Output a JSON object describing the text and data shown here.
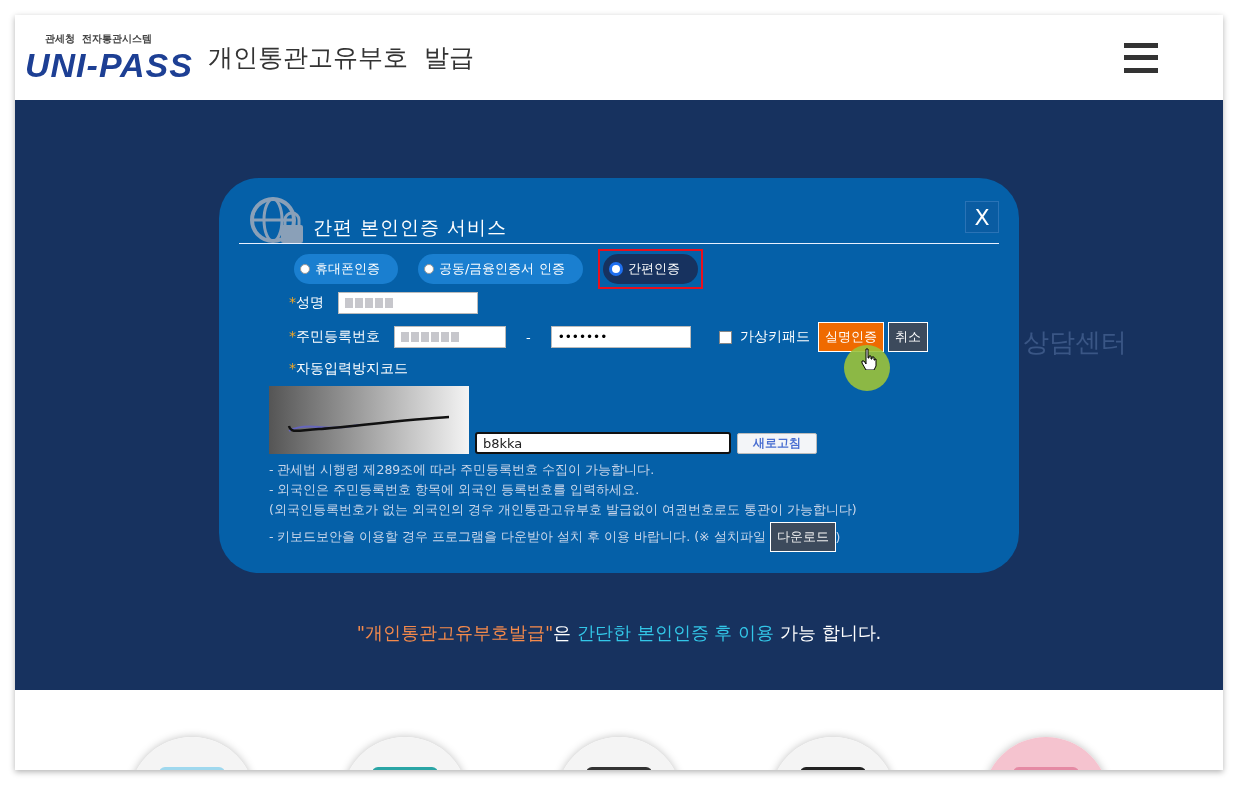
{
  "header": {
    "logo_caption": "관세청  전자통관시스템",
    "logo_text": "UNI-PASS",
    "title": "개인통관고유부호  발급"
  },
  "background_texts": [
    "상담센터"
  ],
  "modal": {
    "title": "간편 본인인증 서비스",
    "close": "X",
    "auth_tabs": [
      {
        "label": "휴대폰인증",
        "selected": false,
        "highlighted": false
      },
      {
        "label": "공동/금융인증서 인증",
        "selected": false,
        "highlighted": false
      },
      {
        "label": "간편인증",
        "selected": true,
        "highlighted": true
      }
    ],
    "name_row": {
      "marker": "*",
      "label": "성명"
    },
    "resident_row": {
      "marker": "*",
      "label": "주민등록번호",
      "separator": "-",
      "second_value": "•••••••"
    },
    "virtual_keypad": {
      "label": "가상키패드",
      "checked": false
    },
    "buttons": [
      {
        "label": "실명인증",
        "kind": "primary"
      },
      {
        "label": "취소",
        "kind": "secondary"
      }
    ],
    "captcha": {
      "marker": "*",
      "label": "자동입력방지코드",
      "value": "b8kka",
      "refresh": "새로고침"
    },
    "notes": [
      "- 관세법 시행령 제289조에 따라 주민등록번호 수집이 가능합니다.",
      "- 외국인은 주민등록번호 항목에 외국인 등록번호를 입력하세요.",
      "(외국인등록번호가 없는 외국인의 경우 개인통관고유부호 발급없이 여권번호로도 통관이 가능합니다)"
    ],
    "download_note": {
      "text": "- 키보드보안을 이용할 경우 프로그램을 다운받아 설치 후 이용 바랍니다. (※ 설치파일",
      "button": "다운로드",
      "tail": ")"
    }
  },
  "footer_message": [
    {
      "text": "\"개인통관고유부호발급\"",
      "color": "#f58a4b"
    },
    {
      "text": "은 ",
      "color": "#ffffff"
    },
    {
      "text": "간단한 본인인증 후 이용",
      "color": "#33c7e8"
    },
    {
      "text": " 가능 합니다.",
      "color": "#ffffff"
    }
  ],
  "services": [
    {
      "kind": "picture"
    },
    {
      "kind": "picture"
    },
    {
      "kind": "picture"
    },
    {
      "kind": "picture"
    },
    {
      "kind": "picture"
    }
  ]
}
